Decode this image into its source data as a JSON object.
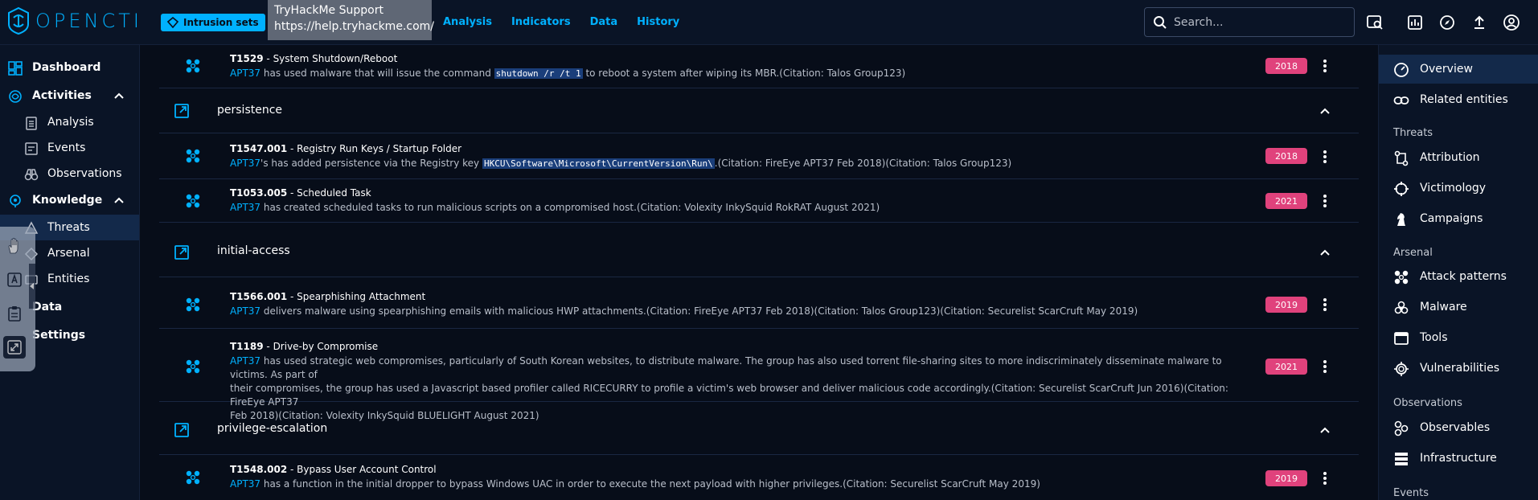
{
  "app": {
    "logo_text": "OPENCTI"
  },
  "breadcrumb": {
    "chip_label": "Intrusion sets"
  },
  "tooltip": {
    "title": "TryHackMe Support",
    "url": "https://help.tryhackme.com/"
  },
  "topnav": {
    "items": [
      "Analysis",
      "Indicators",
      "Data",
      "History"
    ]
  },
  "search": {
    "placeholder": "Search..."
  },
  "leftnav": {
    "dashboard": "Dashboard",
    "activities": "Activities",
    "analysis": "Analysis",
    "events": "Events",
    "observations": "Observations",
    "knowledge": "Knowledge",
    "threats": "Threats",
    "arsenal": "Arsenal",
    "entities": "Entities",
    "data": "Data",
    "settings": "Settings"
  },
  "main": {
    "rows": [
      {
        "id": "T1529",
        "name": "System Shutdown/Reboot",
        "actor": "APT37",
        "pre": " has used malware that will issue the command ",
        "code": "shutdown /r /t 1",
        "post": " to reboot a system after wiping its MBR.(Citation: Talos Group123)",
        "year": "2018"
      },
      {
        "id": "T1547.001",
        "name": "Registry Run Keys / Startup Folder",
        "actor": "APT37",
        "pre": "'s has added persistence via the Registry key ",
        "code": "HKCU\\Software\\Microsoft\\CurrentVersion\\Run\\",
        "post": ".(Citation: FireEye APT37 Feb 2018)(Citation: Talos Group123)",
        "year": "2018"
      },
      {
        "id": "T1053.005",
        "name": "Scheduled Task",
        "actor": "APT37",
        "text": " has created scheduled tasks to run malicious scripts on a compromised host.(Citation: Volexity InkySquid RokRAT August 2021)",
        "year": "2021"
      },
      {
        "id": "T1566.001",
        "name": "Spearphishing Attachment",
        "actor": "APT37",
        "text": " delivers malware using spearphishing emails with malicious HWP attachments.(Citation: FireEye APT37 Feb 2018)(Citation: Talos Group123)(Citation: Securelist ScarCruft May 2019)",
        "year": "2019"
      },
      {
        "id": "T1189",
        "name": "Drive-by Compromise",
        "actor": "APT37",
        "line1": " has used strategic web compromises, particularly of South Korean websites, to distribute malware. The group has also used torrent file-sharing sites to more indiscriminately disseminate malware to victims. As part of",
        "line2": "their compromises, the group has used a Javascript based profiler called RICECURRY to profile a victim's web browser and deliver malicious code accordingly.(Citation: Securelist ScarCruft Jun 2016)(Citation: FireEye APT37",
        "line3": "Feb 2018)(Citation: Volexity InkySquid BLUELIGHT August 2021)",
        "year": "2021"
      },
      {
        "id": "T1548.002",
        "name": "Bypass User Account Control",
        "actor": "APT37",
        "text": " has a function in the initial dropper to bypass Windows UAC in order to execute the next payload with higher privileges.(Citation: Securelist ScarCruft May 2019)",
        "year": "2019"
      }
    ],
    "phases": [
      "persistence",
      "initial-access",
      "privilege-escalation"
    ]
  },
  "rightnav": {
    "overview": "Overview",
    "related": "Related entities",
    "threats_head": "Threats",
    "attribution": "Attribution",
    "victimology": "Victimology",
    "campaigns": "Campaigns",
    "arsenal_head": "Arsenal",
    "attack_patterns": "Attack patterns",
    "malware": "Malware",
    "tools": "Tools",
    "vulnerabilities": "Vulnerabilities",
    "observations_head": "Observations",
    "observables": "Observables",
    "infrastructure": "Infrastructure",
    "events_head": "Events"
  },
  "colors": {
    "accent": "#00b1ff",
    "badge": "#e0427c",
    "background": "#070d19"
  }
}
